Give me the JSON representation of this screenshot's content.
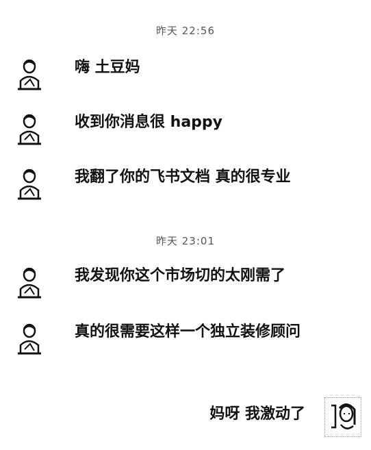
{
  "chat": {
    "timestamps": [
      "昨天 22:56",
      "昨天 23:01"
    ],
    "messages": [
      {
        "sender": "other",
        "text": "嗨 土豆妈"
      },
      {
        "sender": "other",
        "text": "收到你消息很 happy"
      },
      {
        "sender": "other",
        "text": "我翻了你的飞书文档 真的很专业"
      },
      {
        "sender": "other",
        "text": "我发现你这个市场切的太刚需了"
      },
      {
        "sender": "other",
        "text": "真的很需要这样一个独立装修顾问"
      },
      {
        "sender": "self",
        "text": "妈呀 我激动了"
      }
    ]
  }
}
